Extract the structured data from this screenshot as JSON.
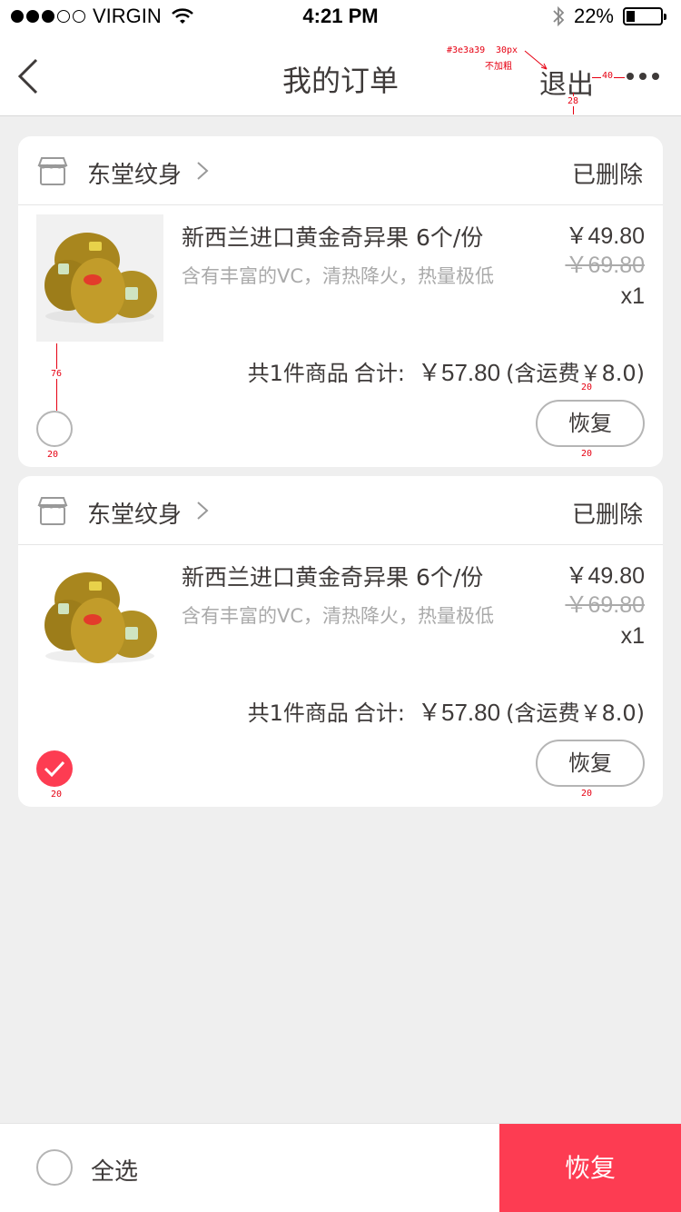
{
  "status_bar": {
    "carrier": "VIRGIN",
    "time": "4:21 PM",
    "battery": "22%",
    "battery_level": 0.22
  },
  "nav": {
    "title": "我的订单",
    "logout_label": "退出",
    "more_icon": "more-icon",
    "back_icon": "back-icon"
  },
  "annotations": {
    "color_note": "#3e3a39",
    "size_note": "30px",
    "weight_note": "不加粗",
    "gap_40": "40",
    "gap_28": "28",
    "gap_76": "76",
    "gap_20": "20"
  },
  "orders": [
    {
      "shop_name": "东堂纹身",
      "status": "已删除",
      "product_name": "新西兰进口黄金奇异果 6个/份",
      "product_desc": "含有丰富的VC，清热降火，热量极低",
      "price": "￥49.80",
      "original_price": "￥69.80",
      "quantity": "x1",
      "count_text": "共1件商品",
      "total_label": "合计:",
      "total": "￥57.80",
      "shipping": "(含运费￥8.0)",
      "restore_label": "恢复",
      "selected": false
    },
    {
      "shop_name": "东堂纹身",
      "status": "已删除",
      "product_name": "新西兰进口黄金奇异果 6个/份",
      "product_desc": "含有丰富的VC，清热降火，热量极低",
      "price": "￥49.80",
      "original_price": "￥69.80",
      "quantity": "x1",
      "count_text": "共1件商品",
      "total_label": "合计:",
      "total": "￥57.80",
      "shipping": "(含运费￥8.0)",
      "restore_label": "恢复",
      "selected": true
    }
  ],
  "bottom_bar": {
    "select_all_label": "全选",
    "restore_label": "恢复"
  },
  "colors": {
    "accent": "#fd3c52",
    "text": "#3e3a39",
    "muted": "#aaaaaa",
    "background": "#efefef"
  }
}
